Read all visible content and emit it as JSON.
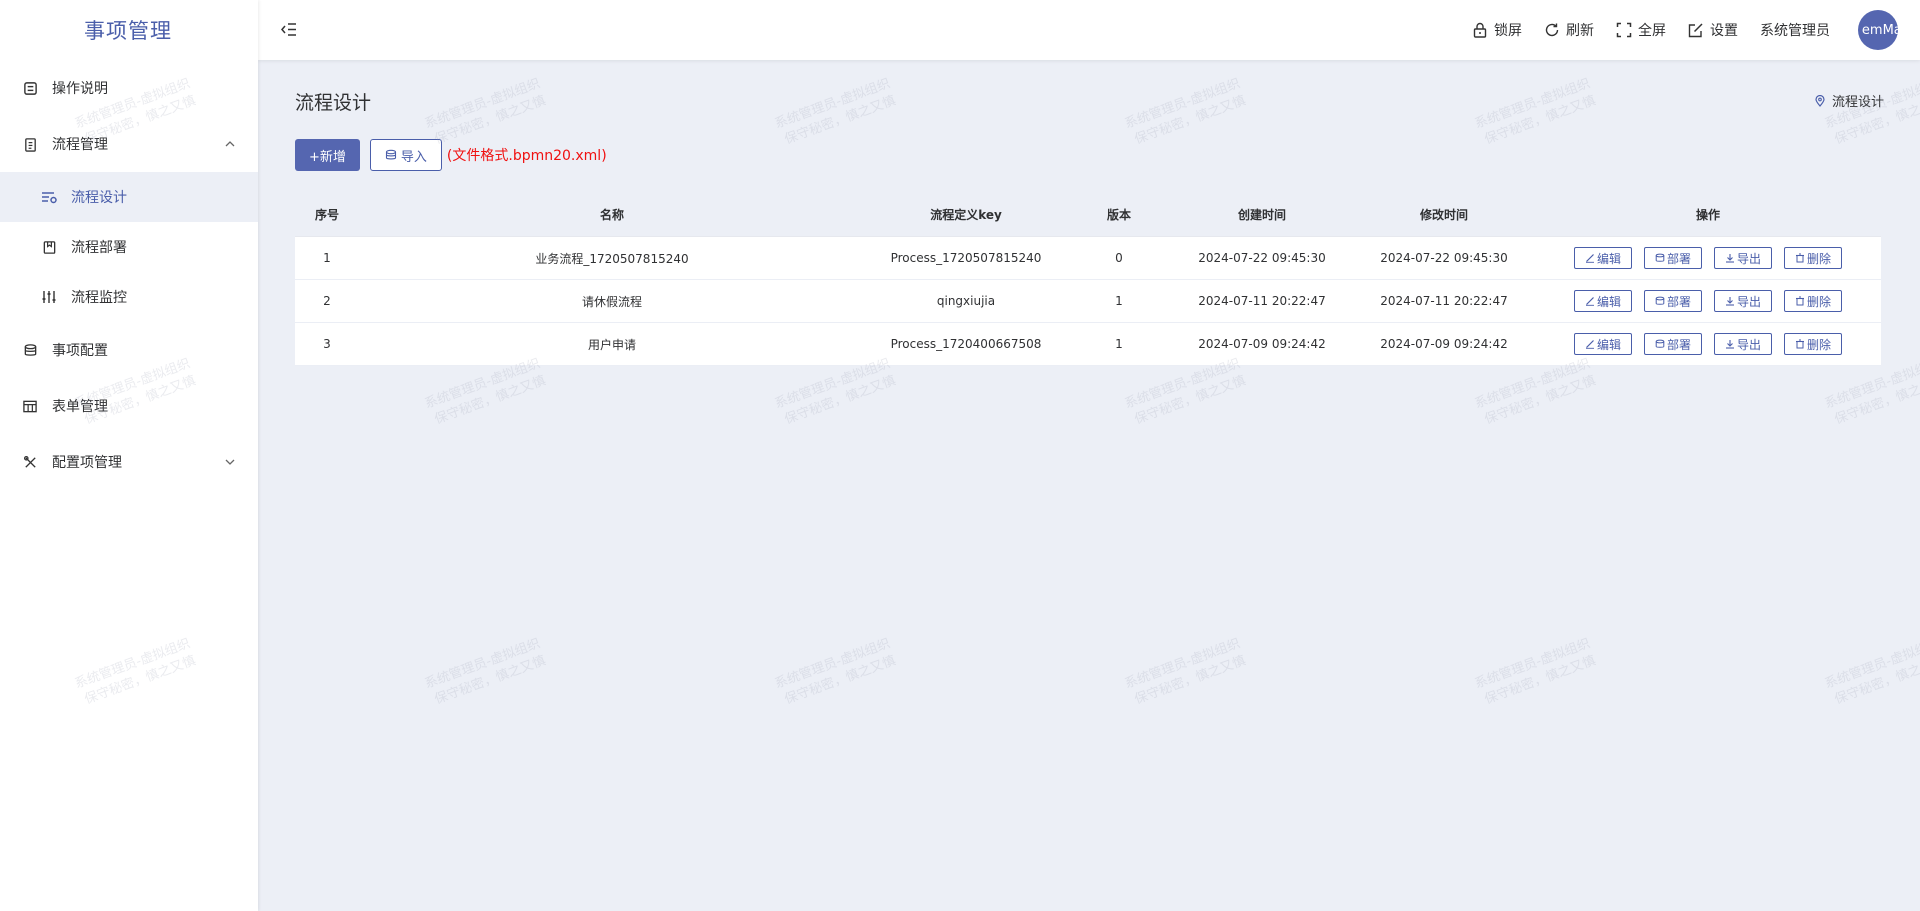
{
  "app": {
    "title": "事项管理"
  },
  "header": {
    "lock_label": "锁屏",
    "refresh_label": "刷新",
    "fullscreen_label": "全屏",
    "settings_label": "设置",
    "username": "系统管理员",
    "avatar_text": "emMan"
  },
  "sidebar": {
    "items": [
      {
        "label": "操作说明",
        "icon": "document-icon"
      },
      {
        "label": "流程管理",
        "icon": "clipboard-icon",
        "expanded": true,
        "children": [
          {
            "label": "流程设计",
            "icon": "flow-design-icon",
            "active": true
          },
          {
            "label": "流程部署",
            "icon": "deploy-icon"
          },
          {
            "label": "流程监控",
            "icon": "monitor-icon"
          }
        ]
      },
      {
        "label": "事项配置",
        "icon": "database-icon"
      },
      {
        "label": "表单管理",
        "icon": "table-icon"
      },
      {
        "label": "配置项管理",
        "icon": "tools-icon",
        "expanded": false
      }
    ]
  },
  "page": {
    "title": "流程设计",
    "breadcrumb": "流程设计",
    "add_label": "+新增",
    "import_label": "导入",
    "import_hint": "(文件格式.bpmn20.xml)"
  },
  "table": {
    "columns": [
      "序号",
      "名称",
      "流程定义key",
      "版本",
      "创建时间",
      "修改时间",
      "操作"
    ],
    "rows": [
      {
        "index": "1",
        "name": "业务流程_1720507815240",
        "key": "Process_1720507815240",
        "version": "0",
        "created": "2024-07-22 09:45:30",
        "modified": "2024-07-22 09:45:30"
      },
      {
        "index": "2",
        "name": "请休假流程",
        "key": "qingxiujia",
        "version": "1",
        "created": "2024-07-11 20:22:47",
        "modified": "2024-07-11 20:22:47"
      },
      {
        "index": "3",
        "name": "用户申请",
        "key": "Process_1720400667508",
        "version": "1",
        "created": "2024-07-09 09:24:42",
        "modified": "2024-07-09 09:24:42"
      }
    ],
    "ops": {
      "edit": "编辑",
      "deploy": "部署",
      "export": "导出",
      "delete": "删除"
    }
  },
  "watermark": {
    "line1": "系统管理员-虚拟组织",
    "line2": "保守秘密，慎之又慎"
  },
  "colors": {
    "accent": "#5566b0",
    "hint": "#f01010",
    "bg": "#eceff6"
  }
}
